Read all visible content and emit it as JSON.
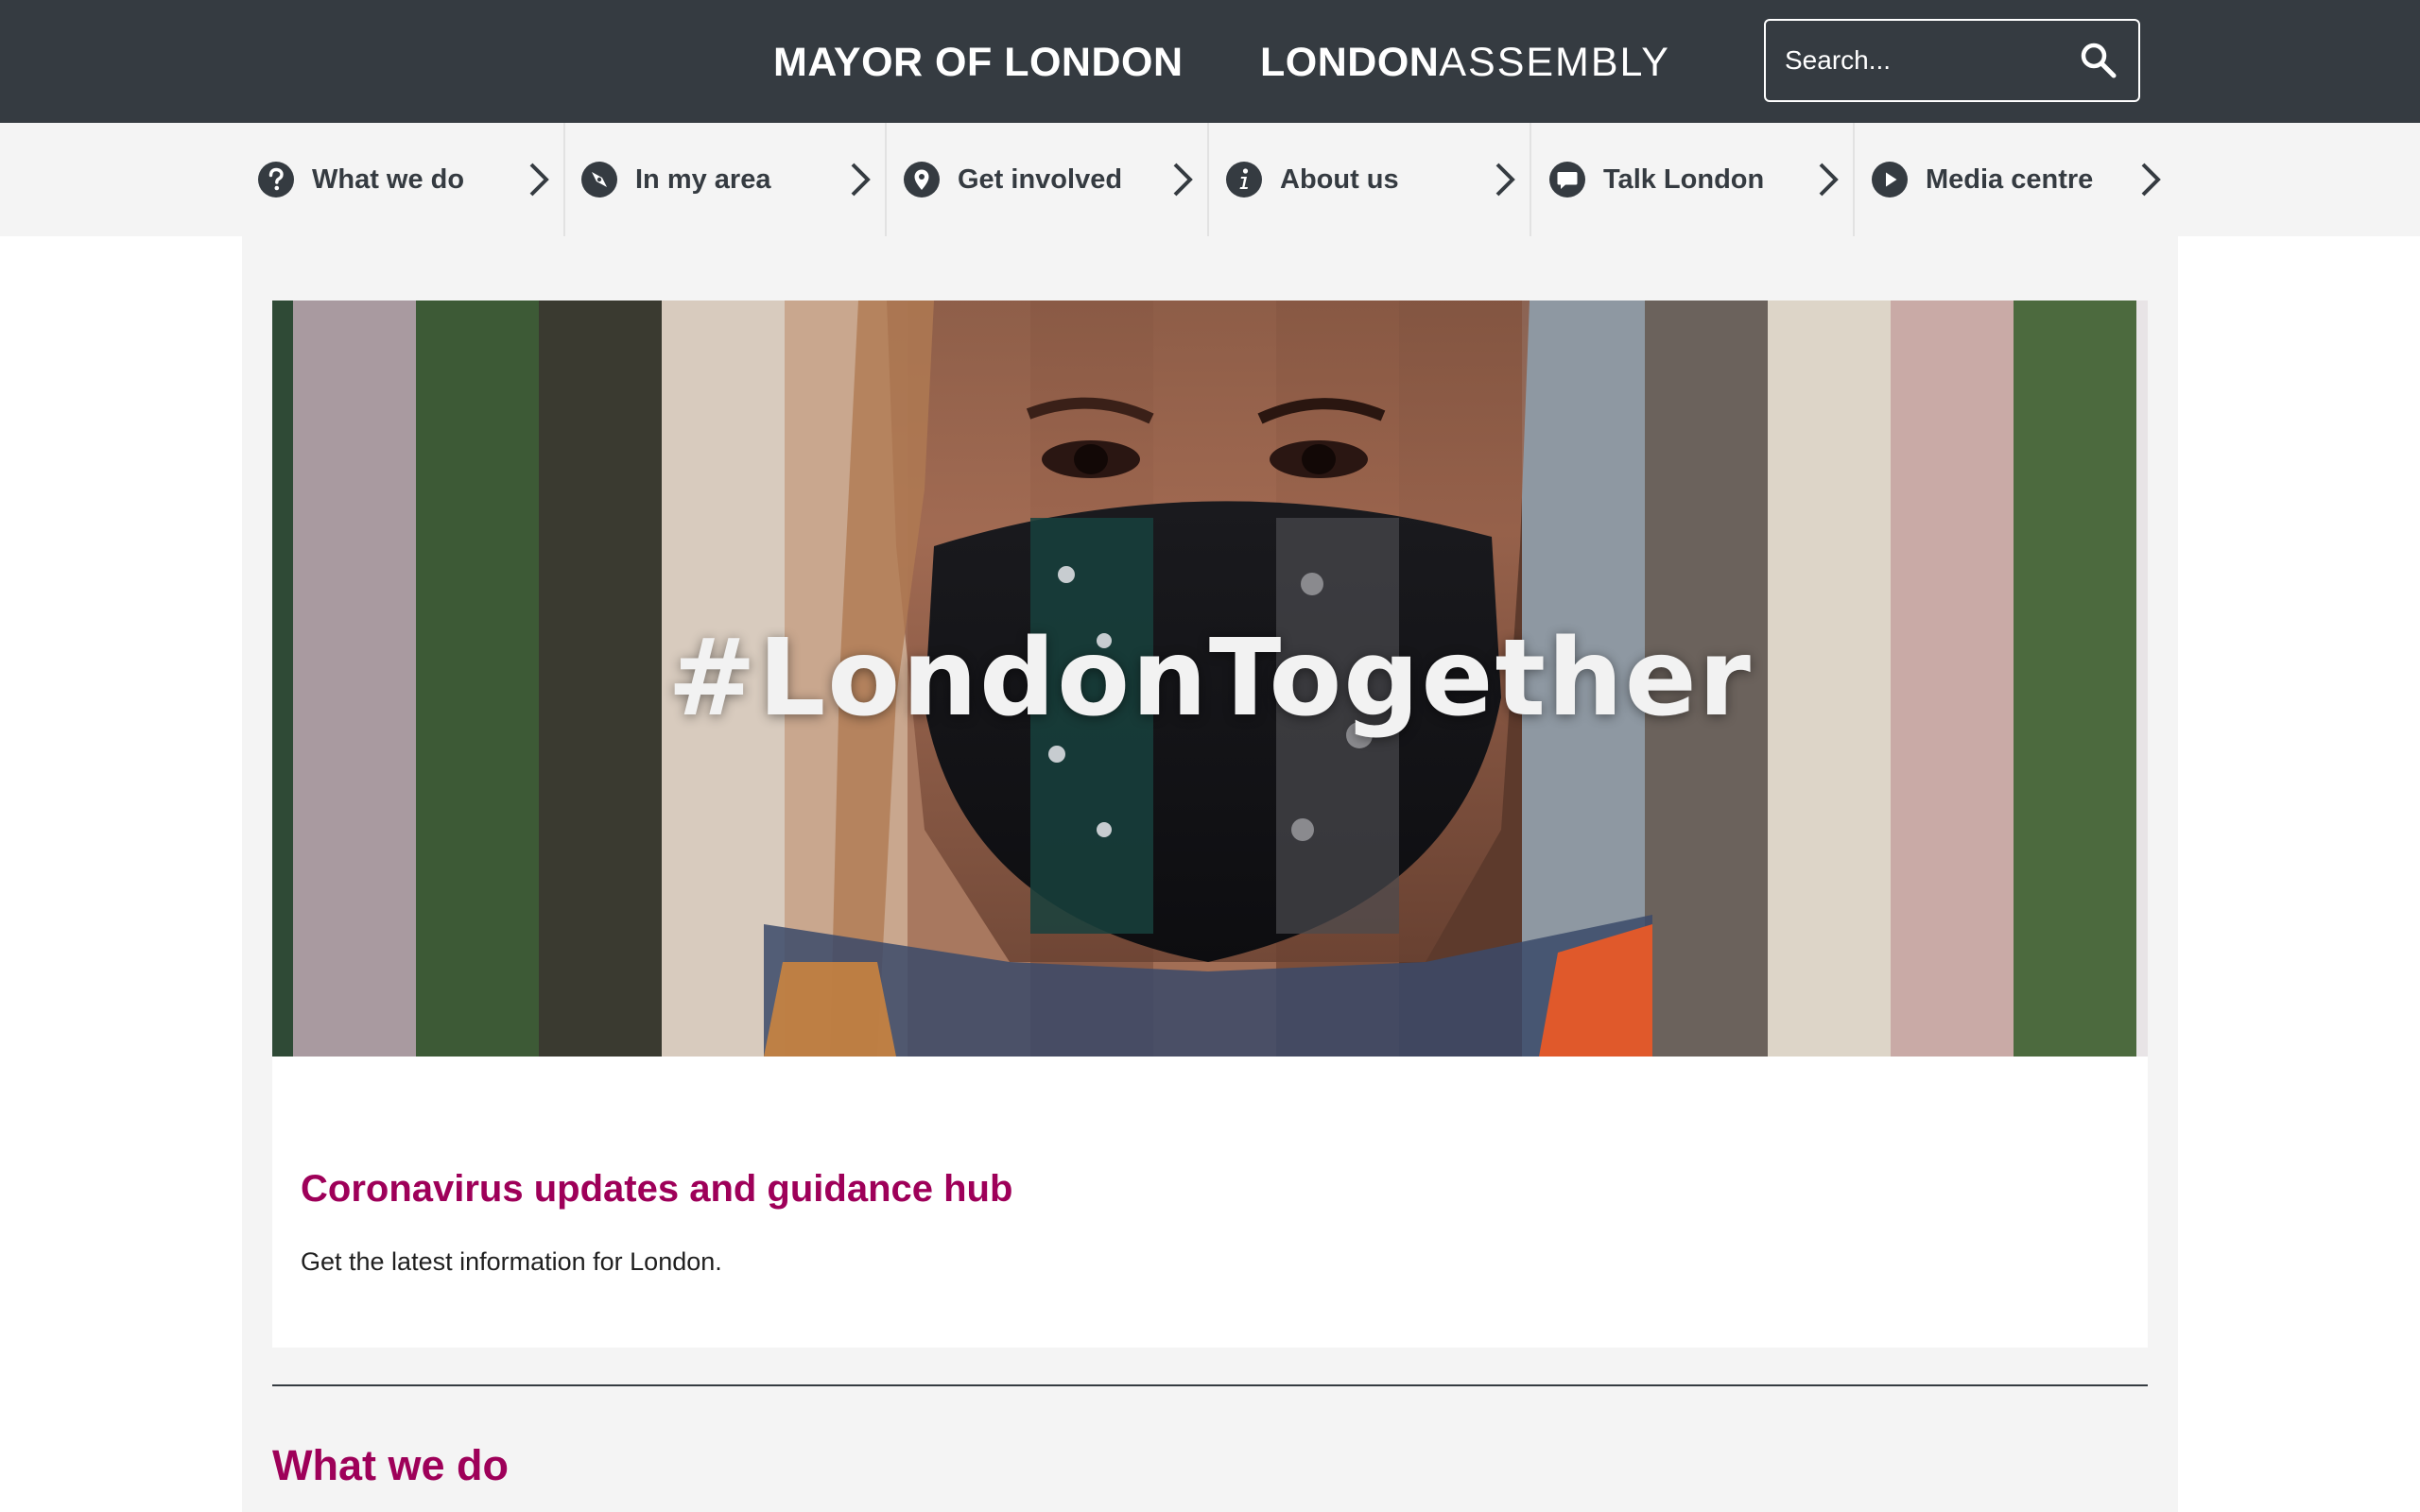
{
  "header": {
    "mayor_label": "MAYOR OF LONDON",
    "assembly_bold": "LONDON",
    "assembly_light": "ASSEMBLY",
    "search_placeholder": "Search..."
  },
  "nav": {
    "items": [
      {
        "label": "What we do",
        "icon": "question-circle-icon"
      },
      {
        "label": "In my area",
        "icon": "compass-icon"
      },
      {
        "label": "Get involved",
        "icon": "map-pin-icon"
      },
      {
        "label": "About us",
        "icon": "info-circle-icon"
      },
      {
        "label": "Talk London",
        "icon": "speech-bubble-icon"
      },
      {
        "label": "Media centre",
        "icon": "play-circle-icon"
      }
    ]
  },
  "promo": {
    "hero_caption": "#LondonTogether",
    "title": "Coronavirus updates and guidance hub",
    "description": "Get the latest information for London."
  },
  "section": {
    "title": "What we do"
  },
  "colors": {
    "header_bg": "#353b41",
    "nav_bg": "#f4f4f4",
    "accent": "#9e0059",
    "text": "#1f1f1f"
  }
}
